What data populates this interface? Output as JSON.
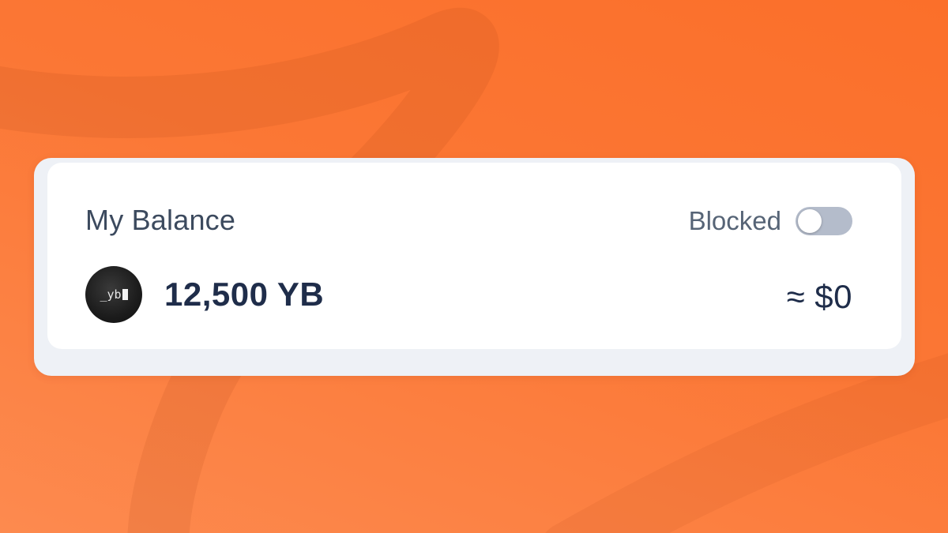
{
  "balance_card": {
    "title": "My Balance",
    "blocked_label": "Blocked",
    "blocked_toggle_on": false,
    "token_logo_text": "_yb",
    "token_amount": "12,500 YB",
    "usd_value": "≈ $0"
  },
  "colors": {
    "background_orange": "#fb7735",
    "card_frame": "#eef1f6",
    "card_surface": "#ffffff",
    "amount_text": "#1f2d4a",
    "toggle_off": "#b4bccb"
  },
  "icons": {
    "token_logo": "yb-token-logo-icon"
  }
}
